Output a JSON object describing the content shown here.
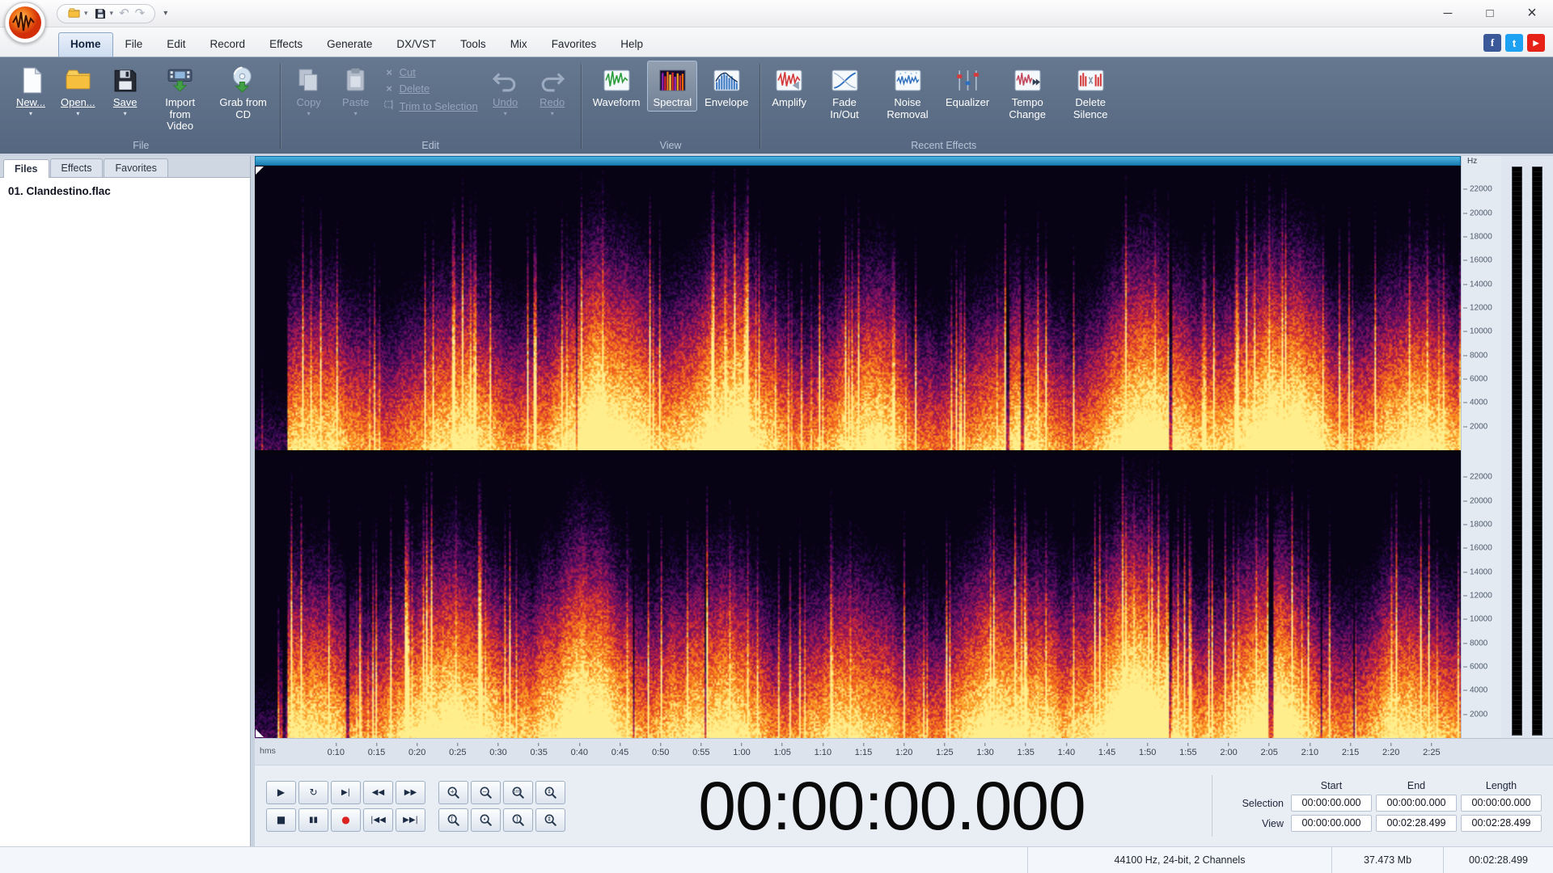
{
  "glyphs": {
    "dropdown": "▾",
    "minimize": "─",
    "maximize": "□",
    "close": "×",
    "undo": "↶",
    "redo": "↷",
    "cross": "×"
  },
  "social": {
    "facebook": "f",
    "twitter": "t",
    "youtube": "▶"
  },
  "menu": {
    "tabs": [
      "Home",
      "File",
      "Edit",
      "Record",
      "Effects",
      "Generate",
      "DX/VST",
      "Tools",
      "Mix",
      "Favorites",
      "Help"
    ],
    "active": "Home"
  },
  "ribbon": {
    "file": {
      "label": "File",
      "new": "New...",
      "open": "Open...",
      "save": "Save",
      "import_video": "Import from Video",
      "grab_cd": "Grab from CD"
    },
    "edit": {
      "label": "Edit",
      "copy": "Copy",
      "paste": "Paste",
      "cut": "Cut",
      "delete": "Delete",
      "trim": "Trim to Selection",
      "undo": "Undo",
      "redo": "Redo"
    },
    "view": {
      "label": "View",
      "waveform": "Waveform",
      "spectral": "Spectral",
      "envelope": "Envelope",
      "selected": "Spectral"
    },
    "recent": {
      "label": "Recent Effects",
      "amplify": "Amplify",
      "fade": "Fade In/Out",
      "noise": "Noise Removal",
      "equalizer": "Equalizer",
      "tempo": "Tempo Change",
      "silence": "Delete Silence"
    }
  },
  "sidebar": {
    "tabs": [
      "Files",
      "Effects",
      "Favorites"
    ],
    "active": "Files",
    "files": [
      "01. Clandestino.flac"
    ]
  },
  "spectral_view": {
    "freq_unit": "Hz",
    "freq_max": 24000,
    "freq_ticks": [
      22000,
      20000,
      18000,
      16000,
      14000,
      12000,
      10000,
      8000,
      6000,
      4000,
      2000
    ],
    "channels": 2,
    "seed": 1337,
    "intro_silence_fraction": 0.027,
    "colormap": [
      [
        8,
        3,
        20
      ],
      [
        28,
        6,
        58
      ],
      [
        80,
        12,
        98
      ],
      [
        140,
        18,
        92
      ],
      [
        205,
        40,
        56
      ],
      [
        242,
        100,
        28
      ],
      [
        252,
        166,
        38
      ],
      [
        255,
        238,
        140
      ]
    ]
  },
  "timeline": {
    "unit_label": "hms",
    "total_seconds": 148.499,
    "tick_labels": [
      "0:10",
      "0:15",
      "0:20",
      "0:25",
      "0:30",
      "0:35",
      "0:40",
      "0:45",
      "0:50",
      "0:55",
      "1:00",
      "1:05",
      "1:10",
      "1:15",
      "1:20",
      "1:25",
      "1:30",
      "1:35",
      "1:40",
      "1:45",
      "1:50",
      "1:55",
      "2:00",
      "2:05",
      "2:10",
      "2:15",
      "2:20",
      "2:25"
    ]
  },
  "transport": {
    "row1": [
      {
        "name": "play",
        "glyph": "▶"
      },
      {
        "name": "loop",
        "glyph": "↻"
      },
      {
        "name": "play-to-end",
        "glyph": "▶|"
      },
      {
        "name": "rewind",
        "glyph": "◀◀"
      },
      {
        "name": "fast-forward",
        "glyph": "▶▶"
      }
    ],
    "row2": [
      {
        "name": "stop",
        "glyph": "■"
      },
      {
        "name": "pause",
        "glyph": "▮▮"
      },
      {
        "name": "record",
        "glyph": "●",
        "color": "#dd2222"
      },
      {
        "name": "go-to-start",
        "glyph": "|◀◀"
      },
      {
        "name": "go-to-end",
        "glyph": "▶▶|"
      }
    ],
    "zoom_row1": [
      {
        "name": "zoom-in",
        "sub": "+"
      },
      {
        "name": "zoom-out",
        "sub": "−"
      },
      {
        "name": "zoom-100",
        "sub": "100"
      },
      {
        "name": "zoom-vertical-in",
        "sub": "⇕"
      }
    ],
    "zoom_row2": [
      {
        "name": "zoom-selection-start",
        "sub": "["
      },
      {
        "name": "zoom-full",
        "sub": "∙"
      },
      {
        "name": "zoom-selection-end",
        "sub": "]"
      },
      {
        "name": "zoom-vertical-out",
        "sub": "⇕"
      }
    ]
  },
  "time_display": "00:00:00.000",
  "position_panel": {
    "headers": [
      "Start",
      "End",
      "Length"
    ],
    "rows": [
      {
        "label": "Selection",
        "values": [
          "00:00:00.000",
          "00:00:00.000",
          "00:00:00.000"
        ]
      },
      {
        "label": "View",
        "values": [
          "00:00:00.000",
          "00:02:28.499",
          "00:02:28.499"
        ]
      }
    ]
  },
  "status_bar": {
    "format": "44100 Hz, 24-bit, 2 Channels",
    "file_size": "37.473 Mb",
    "duration": "00:02:28.499"
  }
}
